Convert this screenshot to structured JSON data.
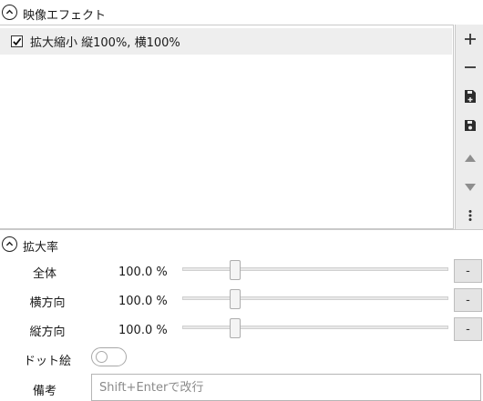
{
  "effects_section": {
    "title": "映像エフェクト",
    "items": [
      {
        "label": "拡大縮小 縦100%, 横100%",
        "checked": true
      }
    ],
    "toolbar": {
      "add": "+",
      "remove": "−"
    }
  },
  "scale_section": {
    "title": "拡大率",
    "rows": [
      {
        "label": "全体",
        "value": "100.0 %",
        "button": "-",
        "level": 0.15
      },
      {
        "label": "横方向",
        "value": "100.0 %",
        "button": "-",
        "level": 0.15
      },
      {
        "label": "縦方向",
        "value": "100.0 %",
        "button": "-",
        "level": 0.15
      }
    ],
    "dot_art": {
      "label": "ドット絵",
      "on": false
    },
    "note": {
      "label": "備考",
      "placeholder": "Shift+Enterで改行"
    }
  },
  "colors": {
    "toolbar_bg": "#ececec",
    "selected_row": "#eeeeee",
    "border": "#c9c9c9"
  },
  "icons": [
    "chevron-up-icon",
    "check-icon",
    "plus-icon",
    "minus-icon",
    "save-new-icon",
    "save-icon",
    "arrow-up-icon",
    "arrow-down-icon",
    "more-vertical-icon"
  ]
}
